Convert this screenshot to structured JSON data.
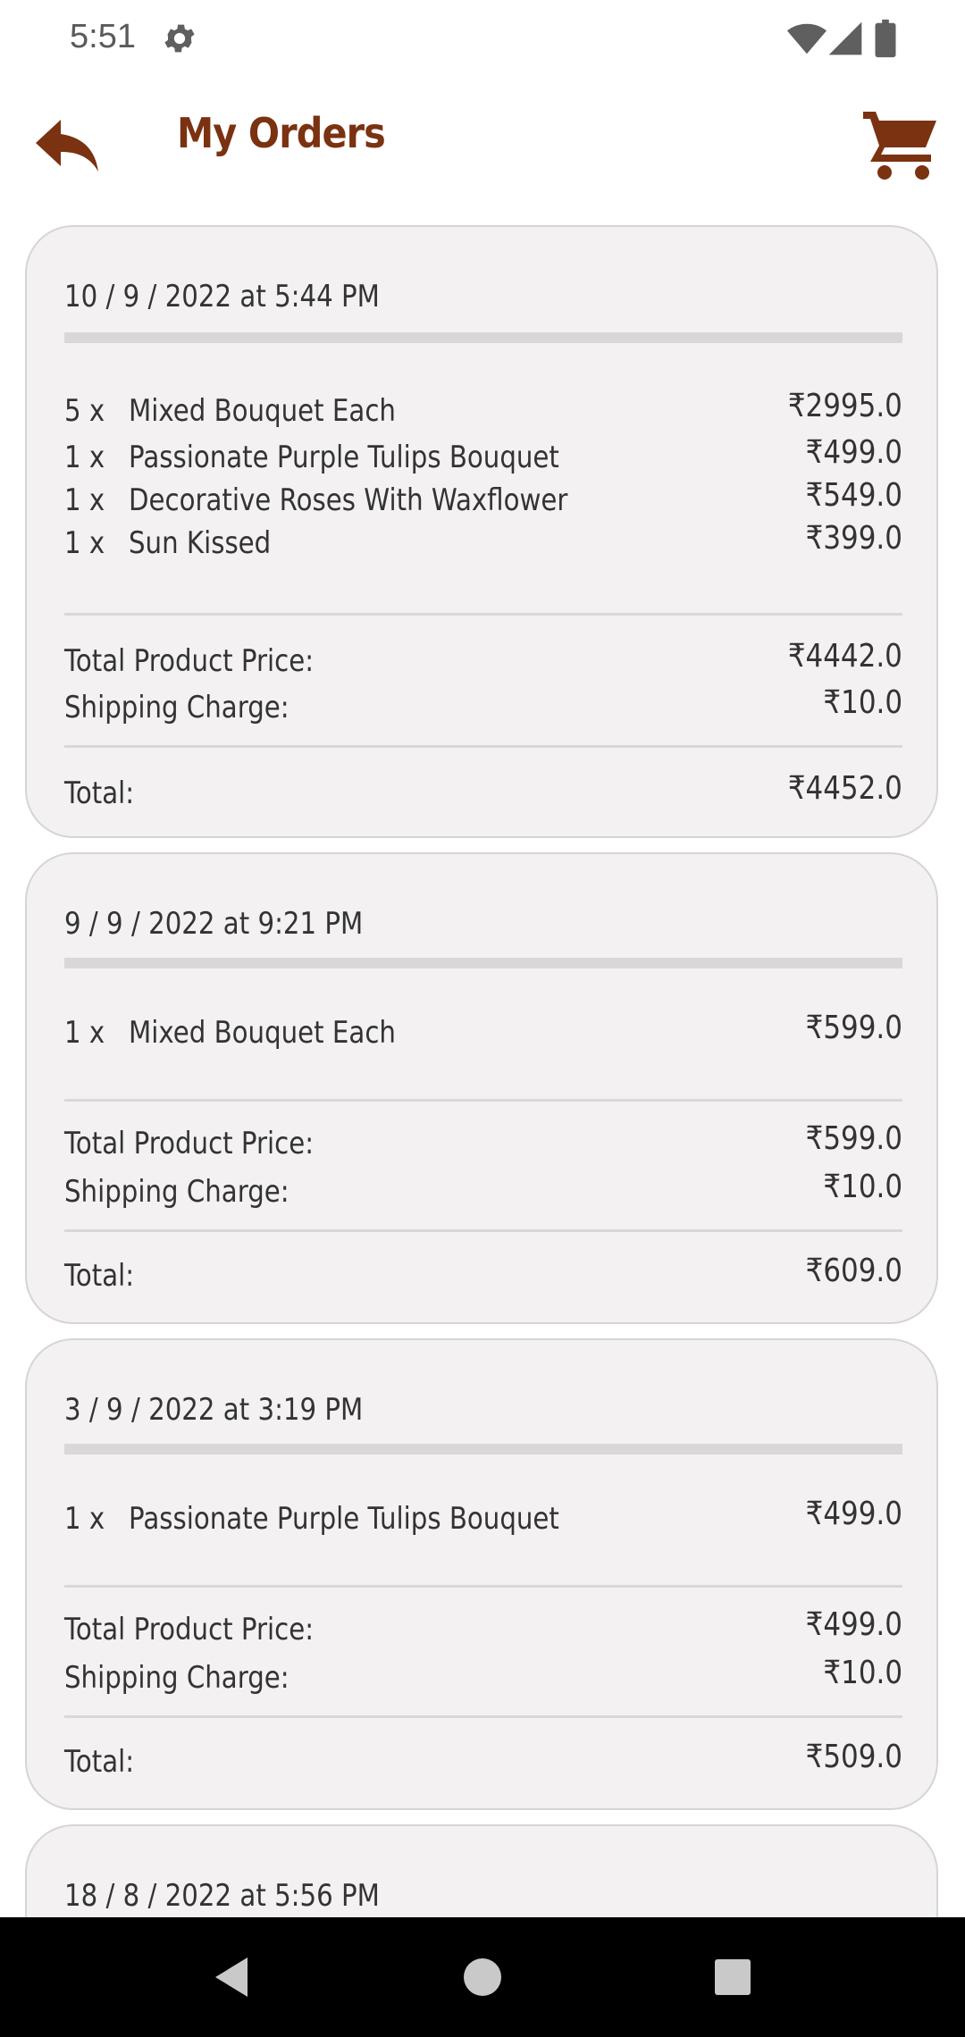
{
  "status_bar": {
    "time": "5:51",
    "icons": [
      "gear-icon",
      "wifi-icon",
      "signal-icon",
      "battery-icon"
    ]
  },
  "app_bar": {
    "back_icon": "reply-arrow-icon",
    "title": "My Orders",
    "cart_icon": "shopping-cart-icon",
    "accent_color": "#7a3211"
  },
  "orders": [
    {
      "date": "10 / 9 / 2022 at 5:44 PM",
      "items": [
        {
          "qty": "5 x",
          "name": "Mixed Bouquet Each",
          "price": "₹2995.0"
        },
        {
          "qty": "1 x",
          "name": "Passionate Purple Tulips Bouquet",
          "price": "₹499.0"
        },
        {
          "qty": "1 x",
          "name": "Decorative Roses With Waxflower",
          "price": "₹549.0"
        },
        {
          "qty": "1 x",
          "name": "Sun Kissed",
          "price": "₹399.0"
        }
      ],
      "total_product_price_label": "Total Product Price:",
      "total_product_price": "₹4442.0",
      "shipping_label": "Shipping Charge:",
      "shipping": "₹10.0",
      "total_label": "Total:",
      "total": "₹4452.0"
    },
    {
      "date": "9 / 9 / 2022 at 9:21 PM",
      "items": [
        {
          "qty": "1 x",
          "name": "Mixed Bouquet Each",
          "price": "₹599.0"
        }
      ],
      "total_product_price_label": "Total Product Price:",
      "total_product_price": "₹599.0",
      "shipping_label": "Shipping Charge:",
      "shipping": "₹10.0",
      "total_label": "Total:",
      "total": "₹609.0"
    },
    {
      "date": "3 / 9 / 2022 at 3:19 PM",
      "items": [
        {
          "qty": "1 x",
          "name": "Passionate Purple Tulips Bouquet",
          "price": "₹499.0"
        }
      ],
      "total_product_price_label": "Total Product Price:",
      "total_product_price": "₹499.0",
      "shipping_label": "Shipping Charge:",
      "shipping": "₹10.0",
      "total_label": "Total:",
      "total": "₹509.0"
    },
    {
      "date": "18 / 8 / 2022 at 5:56 PM"
    }
  ],
  "nav_bar": {
    "buttons": [
      "back-triangle-icon",
      "home-circle-icon",
      "recents-square-icon"
    ]
  }
}
